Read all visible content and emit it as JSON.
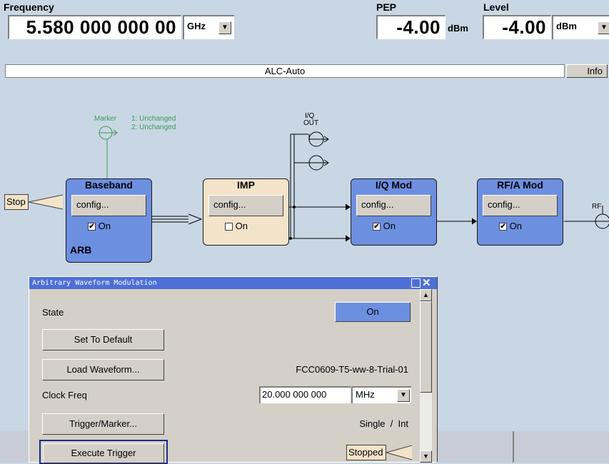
{
  "header": {
    "frequency_label": "Frequency",
    "frequency_value": "5.580 000 000 00",
    "frequency_unit": "GHz",
    "pep_label": "PEP",
    "pep_value": "-4.00",
    "pep_unit": "dBm",
    "level_label": "Level",
    "level_value": "-4.00",
    "level_unit": "dBm",
    "status_text": "ALC-Auto",
    "info_label": "Info"
  },
  "diagram": {
    "marker_label": "Marker",
    "marker1": "1: Unchanged",
    "marker2": "2: Unchanged",
    "iq_out_line1": "I/Q",
    "iq_out_line2": "OUT",
    "trigger_state": "Stop",
    "rf_label": "RF",
    "blocks": [
      {
        "title": "Baseband",
        "config": "config...",
        "on": "On",
        "checked": true,
        "sub": "ARB"
      },
      {
        "title": "IMP",
        "config": "config...",
        "on": "On",
        "checked": false
      },
      {
        "title": "I/Q Mod",
        "config": "config...",
        "on": "On",
        "checked": true
      },
      {
        "title": "RF/A Mod",
        "config": "config...",
        "on": "On",
        "checked": true
      }
    ],
    "check_mark": "✔"
  },
  "dialog": {
    "title": "Arbitrary Waveform Modulation",
    "state_label": "State",
    "state_value": "On",
    "set_default": "Set To Default",
    "load_waveform": "Load Waveform...",
    "waveform_name": "FCC0609-T5-ww-8-Trial-01",
    "clock_label": "Clock Freq",
    "clock_value": "20.000 000 000",
    "clock_unit": "MHz",
    "trigger_marker": "Trigger/Marker...",
    "trigger_mode": "Single  /  Int",
    "execute_trigger": "Execute Trigger",
    "trigger_status": "Stopped"
  },
  "colors": {
    "background": "#c9d7e4",
    "block_blue": "#6d8fe0",
    "block_beige": "#f3e3c8",
    "title_bar": "#4e6fd6",
    "marker_green": "#3a9a55"
  }
}
